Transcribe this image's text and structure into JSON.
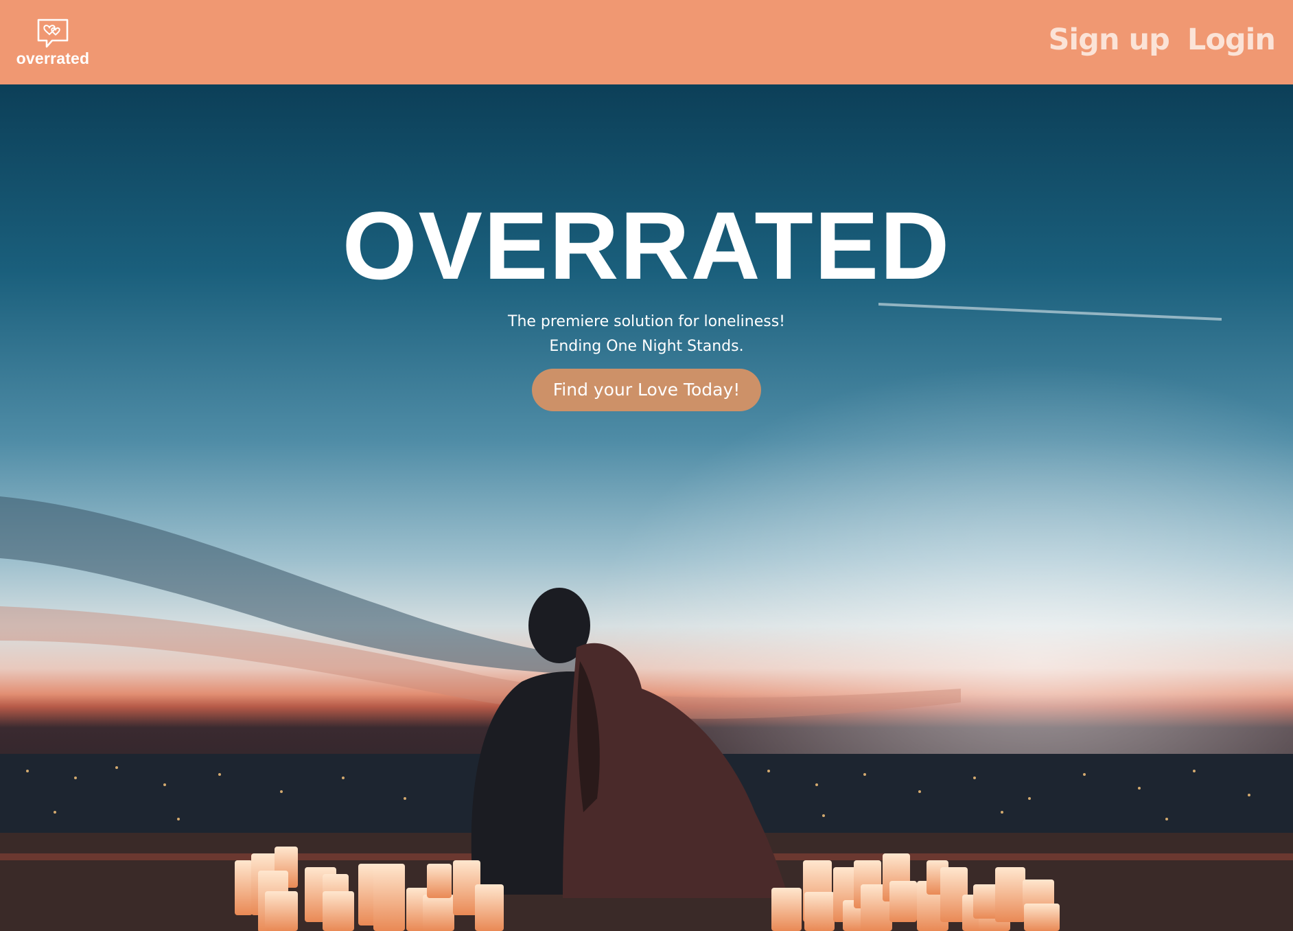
{
  "nav": {
    "logo_text": "overrated",
    "logo_icon": "chat-bubble-hearts-icon",
    "signup_label": "Sign up",
    "login_label": "Login"
  },
  "hero": {
    "title": "OVERRATED",
    "subtitle_line1": "The premiere solution for loneliness!",
    "subtitle_line2": "Ending One Night Stands.",
    "cta_label": "Find your Love Today!"
  },
  "colors": {
    "navbar": "#f09872",
    "cta": "#cd9168",
    "nav_link": "#fbe3d7"
  }
}
